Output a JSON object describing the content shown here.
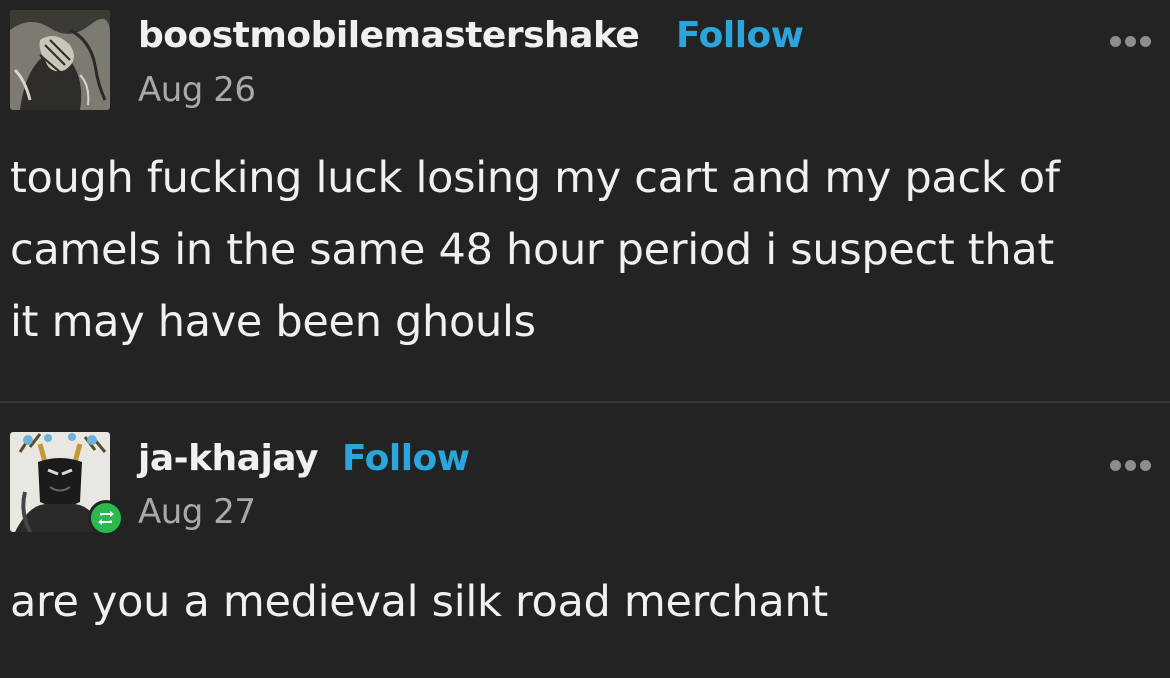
{
  "posts": [
    {
      "username": "boostmobilemastershake",
      "follow_label": "Follow",
      "date": "Aug 26",
      "body_lines": [
        "tough fucking luck losing my cart and my pack of",
        "camels in the same 48 hour period i suspect that",
        "it may have been ghouls"
      ],
      "avatar_icon": "sketch-portrait-avatar",
      "more_icon": "ellipsis-icon"
    },
    {
      "username": "ja-khajay",
      "follow_label": "Follow",
      "date": "Aug 27",
      "body_lines": [
        "are you a medieval silk road merchant"
      ],
      "avatar_icon": "antlered-figure-avatar",
      "badge_icon": "reblog-icon",
      "more_icon": "ellipsis-icon"
    }
  ],
  "colors": {
    "background": "#232323",
    "text": "#f0f0f0",
    "follow": "#2aa6dc",
    "date": "#a9a9a9",
    "badge": "#2bb84e"
  }
}
